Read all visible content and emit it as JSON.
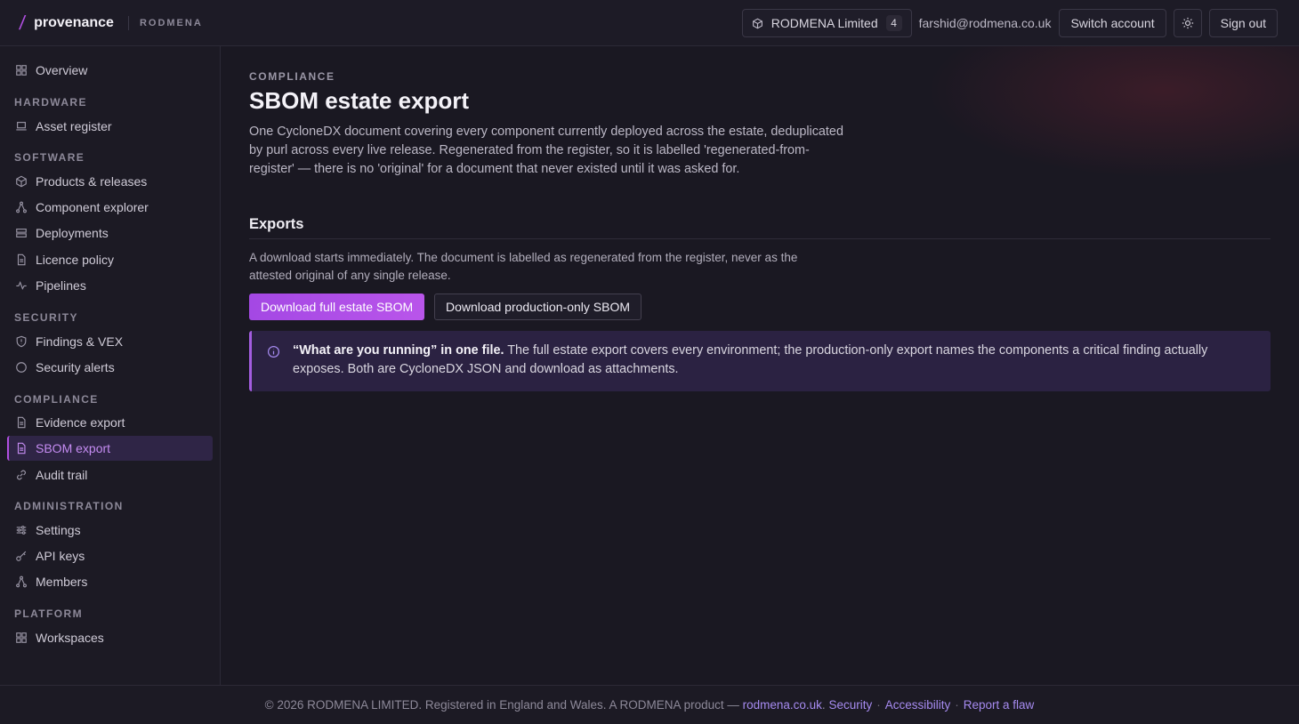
{
  "header": {
    "brand": "provenance",
    "tenant": "RODMENA",
    "org_name": "RODMENA Limited",
    "org_count": "4",
    "user_email": "farshid@rodmena.co.uk",
    "switch_account": "Switch account",
    "sign_out": "Sign out",
    "theme_icon": "sun-icon"
  },
  "sidebar": {
    "overview": "Overview",
    "sections": {
      "hardware": "HARDWARE",
      "software": "SOFTWARE",
      "security": "SECURITY",
      "compliance": "COMPLIANCE",
      "administration": "ADMINISTRATION",
      "platform": "PLATFORM"
    },
    "items": {
      "asset_register": "Asset register",
      "products_releases": "Products & releases",
      "component_explorer": "Component explorer",
      "deployments": "Deployments",
      "licence_policy": "Licence policy",
      "pipelines": "Pipelines",
      "findings_vex": "Findings & VEX",
      "security_alerts": "Security alerts",
      "evidence_export": "Evidence export",
      "sbom_export": "SBOM export",
      "audit_trail": "Audit trail",
      "settings": "Settings",
      "api_keys": "API keys",
      "members": "Members",
      "workspaces": "Workspaces"
    },
    "active": "sbom_export",
    "accent_color": "#b04fe0"
  },
  "main": {
    "eyebrow": "COMPLIANCE",
    "title": "SBOM estate export",
    "lead": "One CycloneDX document covering every component currently deployed across the estate, deduplicated by purl across every live release. Regenerated from the register, so it is labelled 'regenerated-from-register' — there is no 'original' for a document that never existed until it was asked for.",
    "exports_title": "Exports",
    "exports_desc": "A download starts immediately. The document is labelled as regenerated from the register, never as the attested original of any single release.",
    "download_full": "Download full estate SBOM",
    "download_prod": "Download production-only SBOM",
    "callout_bold": "“What are you running” in one file.",
    "callout_text": " The full estate export covers every environment; the production-only export names the components a critical finding actually exposes. Both are CycloneDX JSON and download as attachments."
  },
  "footer": {
    "copyright": "© 2026 RODMENA LIMITED. Registered in England and Wales. A RODMENA product — ",
    "site_link": "rodmena.co.uk",
    "period": ".",
    "security": "Security",
    "accessibility": "Accessibility",
    "report": "Report a flaw",
    "sep": "·"
  }
}
